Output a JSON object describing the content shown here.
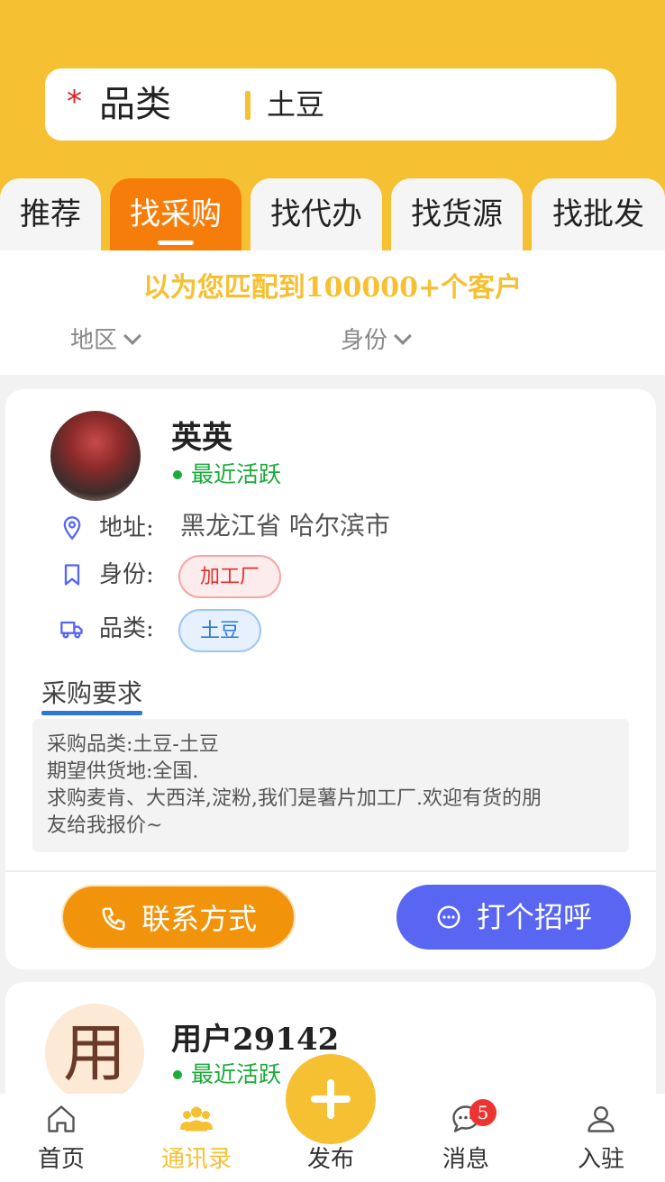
{
  "search": {
    "required_mark": "*",
    "category_label": "品类",
    "category_value": "土豆"
  },
  "tabs": [
    {
      "label": "推荐",
      "active": false
    },
    {
      "label": "找采购",
      "active": true
    },
    {
      "label": "找代办",
      "active": false
    },
    {
      "label": "找货源",
      "active": false
    },
    {
      "label": "找批发",
      "active": false
    }
  ],
  "match_text": "以为您匹配到100000+个客户",
  "filters": {
    "region": "地区",
    "identity": "身份"
  },
  "cards": [
    {
      "name": "英英",
      "status": "最近活跃",
      "address_label": "地址:",
      "address": "黑龙江省 哈尔滨市",
      "identity_label": "身份:",
      "identity_tag": "加工厂",
      "category_label": "品类:",
      "category_tag": "土豆",
      "requirement_title": "采购要求",
      "requirement_lines": [
        "采购品类:土豆-土豆",
        "期望供货地:全国.",
        "求购麦肯、大西洋,淀粉,我们是薯片加工厂.欢迎有货的朋",
        "友给我报价~"
      ],
      "contact_button": "联系方式",
      "greet_button": "打个招呼"
    },
    {
      "avatar_char": "用",
      "name": "用户29142",
      "status": "最近活跃"
    }
  ],
  "bottom_nav": [
    {
      "label": "首页",
      "icon": "home-icon",
      "active": false
    },
    {
      "label": "通讯录",
      "icon": "contacts-icon",
      "active": true
    },
    {
      "label": "发布",
      "icon": "plus-icon",
      "active": false
    },
    {
      "label": "消息",
      "icon": "message-icon",
      "active": false,
      "badge": "5"
    },
    {
      "label": "入驻",
      "icon": "user-icon",
      "active": false
    }
  ],
  "colors": {
    "brand_yellow": "#f6c033",
    "active_tab_orange": "#f77d0a",
    "contact_button": "#f1940c",
    "greet_button": "#5866f2",
    "active_status_green": "#1aab3a"
  }
}
